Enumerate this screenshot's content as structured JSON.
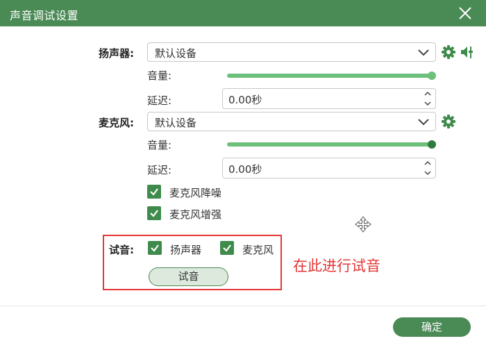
{
  "window": {
    "title": "声音调试设置"
  },
  "speaker": {
    "label": "扬声器:",
    "device": "默认设备",
    "volume_label": "音量:",
    "volume_level": 1.0,
    "delay_label": "延迟:",
    "delay_value": "0.00秒"
  },
  "mic": {
    "label": "麦克风:",
    "device": "默认设备",
    "volume_label": "音量:",
    "volume_level": 1.0,
    "delay_label": "延迟:",
    "delay_value": "0.00秒",
    "noise_reduction_label": "麦克风降噪",
    "noise_reduction_checked": true,
    "enhance_label": "麦克风增强",
    "enhance_checked": true
  },
  "test": {
    "label": "试音:",
    "speaker_label": "扬声器",
    "speaker_checked": true,
    "mic_label": "麦克风",
    "mic_checked": true,
    "button_label": "试音",
    "annotation": "在此进行试音"
  },
  "footer": {
    "ok_label": "确定"
  },
  "colors": {
    "titlebar": "#4a8a55",
    "accent": "#3f8b4c",
    "slider_track": "#6cc07b",
    "annotation_red": "#e53535"
  },
  "icons": {
    "close": "close-icon",
    "settings": "gear-icon",
    "adjust": "speaker-adjust-icon",
    "dropdown": "chevron-down-icon",
    "spinner": "spinner-arrows-icon",
    "move": "move-cursor-icon"
  }
}
